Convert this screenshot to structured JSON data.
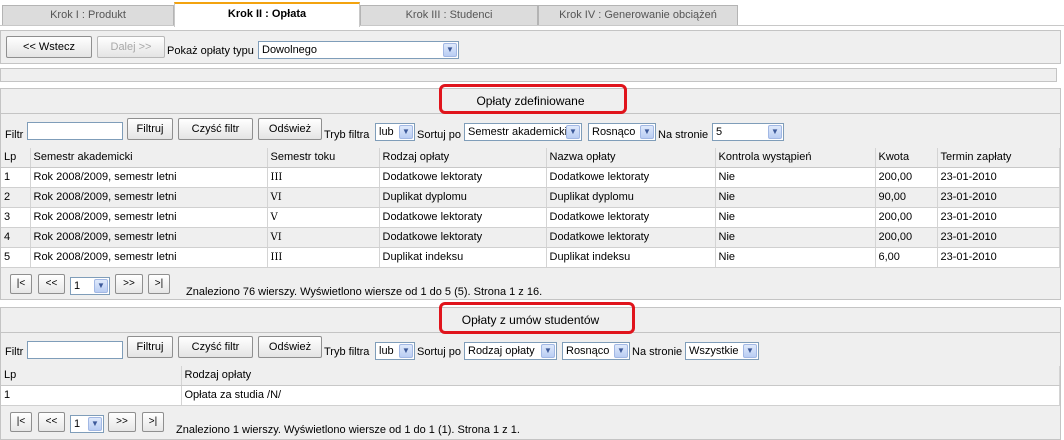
{
  "tabs": [
    {
      "label": "Krok I : Produkt"
    },
    {
      "label": "Krok II : Opłata"
    },
    {
      "label": "Krok III : Studenci"
    },
    {
      "label": "Krok IV : Generowanie obciążeń"
    }
  ],
  "toolbar": {
    "back_label": "<< Wstecz",
    "next_label": "Dalej >>",
    "fee_type_label": "Pokaż opłaty typu",
    "fee_type_value": "Dowolnego"
  },
  "filter": {
    "filter_label": "Filtr",
    "filter_button": "Filtruj",
    "clear_button": "Czyść filtr",
    "refresh_button": "Odśwież",
    "mode_label": "Tryb filtra",
    "mode_value": "lub",
    "sort_label": "Sortuj po",
    "order_value": "Rosnąco",
    "per_page_label": "Na stronie"
  },
  "panel1": {
    "title": "Opłaty zdefiniowane",
    "sort_value": "Semestr akademicki",
    "per_page_value": "5",
    "columns": [
      "Lp",
      "Semestr akademicki",
      "Semestr toku",
      "Rodzaj opłaty",
      "Nazwa opłaty",
      "Kontrola wystąpień",
      "Kwota",
      "Termin zapłaty"
    ],
    "rows": [
      [
        "1",
        "Rok 2008/2009, semestr letni",
        "III",
        "Dodatkowe lektoraty",
        "Dodatkowe lektoraty",
        "Nie",
        "200,00",
        "23-01-2010"
      ],
      [
        "2",
        "Rok 2008/2009, semestr letni",
        "VI",
        "Duplikat dyplomu",
        "Duplikat dyplomu",
        "Nie",
        "90,00",
        "23-01-2010"
      ],
      [
        "3",
        "Rok 2008/2009, semestr letni",
        "V",
        "Dodatkowe lektoraty",
        "Dodatkowe lektoraty",
        "Nie",
        "200,00",
        "23-01-2010"
      ],
      [
        "4",
        "Rok 2008/2009, semestr letni",
        "VI",
        "Dodatkowe lektoraty",
        "Dodatkowe lektoraty",
        "Nie",
        "200,00",
        "23-01-2010"
      ],
      [
        "5",
        "Rok 2008/2009, semestr letni",
        "III",
        "Duplikat indeksu",
        "Duplikat indeksu",
        "Nie",
        "6,00",
        "23-01-2010"
      ]
    ],
    "pager": {
      "first": "|<",
      "prev": "<<",
      "page": "1",
      "next": ">>",
      "last": ">|",
      "status": "Znaleziono 76 wierszy. Wyświetlono wiersze od 1 do 5 (5). Strona 1 z 16."
    }
  },
  "panel2": {
    "title": "Opłaty z umów studentów",
    "sort_value": "Rodzaj opłaty",
    "per_page_value": "Wszystkie",
    "columns": [
      "Lp",
      "Rodzaj opłaty"
    ],
    "rows": [
      [
        "1",
        "Opłata za studia /N/"
      ]
    ],
    "pager": {
      "first": "|<",
      "prev": "<<",
      "page": "1",
      "next": ">>",
      "last": ">|",
      "status": "Znaleziono 1 wierszy. Wyświetlono wiersze od 1 do 1 (1). Strona 1 z 1."
    }
  },
  "colors": {
    "highlight": "#e0141c",
    "active_tab_accent": "#f3a30f"
  }
}
